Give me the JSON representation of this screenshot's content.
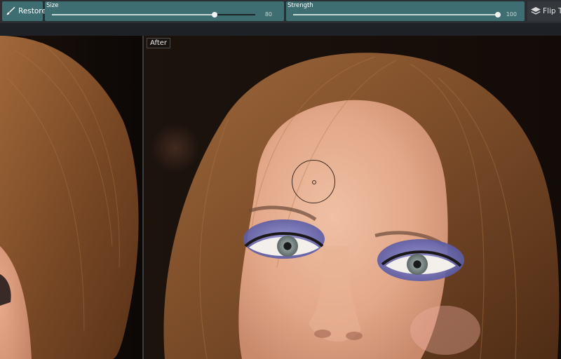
{
  "toolbar": {
    "restore_label": "Restore",
    "size": {
      "label": "Size",
      "value": "80",
      "fraction": 0.8
    },
    "strength": {
      "label": "Strength",
      "value": "100",
      "fraction": 1.0
    },
    "flip_label": "Flip To"
  },
  "viewport": {
    "after_label": "After"
  },
  "icons": [
    "brush-icon",
    "layers-icon"
  ],
  "colors": {
    "toolbar_bg": "#2b2f33",
    "accent_teal": "#3e6e72",
    "eyeshadow": "#6d70b8"
  }
}
